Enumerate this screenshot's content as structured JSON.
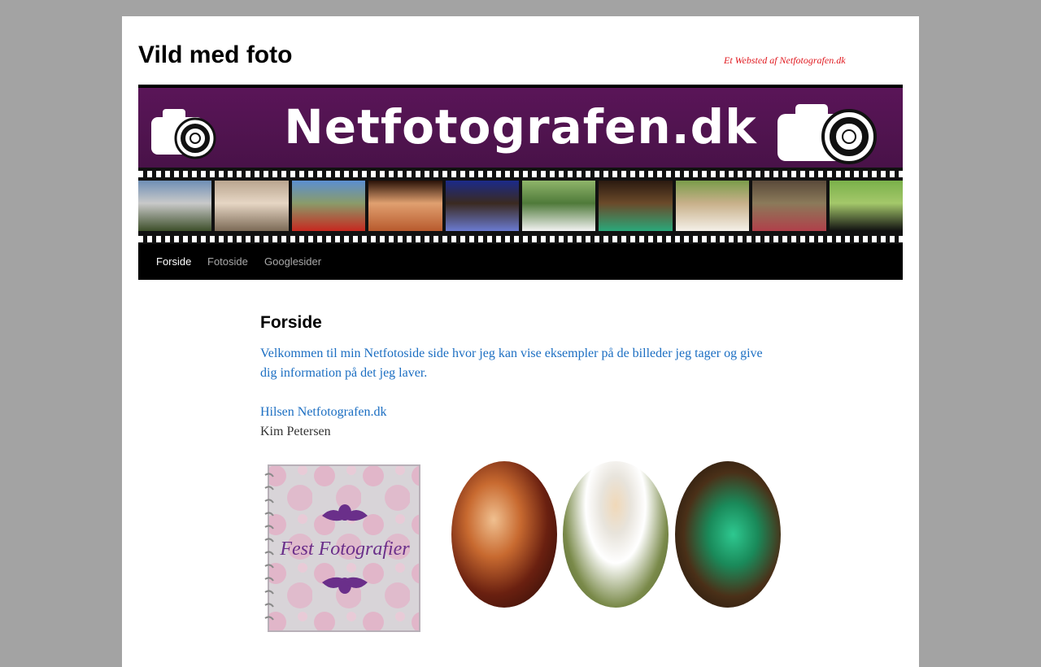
{
  "header": {
    "site_title": "Vild med foto",
    "site_description": "Et Websted af Netfotografen.dk"
  },
  "banner": {
    "title": "Netfotografen.dk",
    "background": "#471247",
    "frames": [
      {
        "name": "cyclists",
        "colors": [
          "#6f8fb5",
          "#3d4f2a",
          "#c9c9c9"
        ]
      },
      {
        "name": "hands-on-tree",
        "colors": [
          "#b9a58f",
          "#7c6a56",
          "#e6d6c4"
        ]
      },
      {
        "name": "red-truck",
        "colors": [
          "#5b8fd1",
          "#c7281f",
          "#8a9b6a"
        ]
      },
      {
        "name": "theatre-couple",
        "colors": [
          "#2a1208",
          "#b85a2d",
          "#e0a070"
        ]
      },
      {
        "name": "wizard-scene",
        "colors": [
          "#1b2a8a",
          "#6a7ad0",
          "#3a2a20"
        ]
      },
      {
        "name": "bride-and-car",
        "colors": [
          "#8fb56a",
          "#f2f2f2",
          "#4f7a3a"
        ]
      },
      {
        "name": "dancers",
        "colors": [
          "#2b1a10",
          "#2aa87a",
          "#6b4a2a"
        ]
      },
      {
        "name": "bridesmaids",
        "colors": [
          "#7a9c4a",
          "#f4f0e8",
          "#c8b08a"
        ]
      },
      {
        "name": "costumed-pair",
        "colors": [
          "#5a4a3a",
          "#b0404a",
          "#8b7a5a"
        ]
      },
      {
        "name": "black-dog",
        "colors": [
          "#7ab04a",
          "#111111",
          "#a4c86a"
        ]
      }
    ]
  },
  "nav": {
    "items": [
      {
        "label": "Forside",
        "current": true
      },
      {
        "label": "Fotoside",
        "current": false
      },
      {
        "label": "Googlesider",
        "current": false
      }
    ]
  },
  "page": {
    "title": "Forside",
    "intro": "Velkommen til min Netfotoside side hvor jeg kan vise eksempler på de billeder jeg tager og give dig information på det jeg laver.",
    "greeting": "Hilsen Netfotografen.dk",
    "author": "Kim Petersen"
  },
  "gallery": {
    "album_caption": "Fest Fotografier",
    "ovals": [
      {
        "name": "theatre-photo"
      },
      {
        "name": "bride-photo"
      },
      {
        "name": "dance-photo"
      }
    ]
  },
  "colors": {
    "page_background": "#a3a3a3",
    "link_blue": "#1b6ec2",
    "description_red": "#e0191f",
    "menu_background": "#000000"
  }
}
